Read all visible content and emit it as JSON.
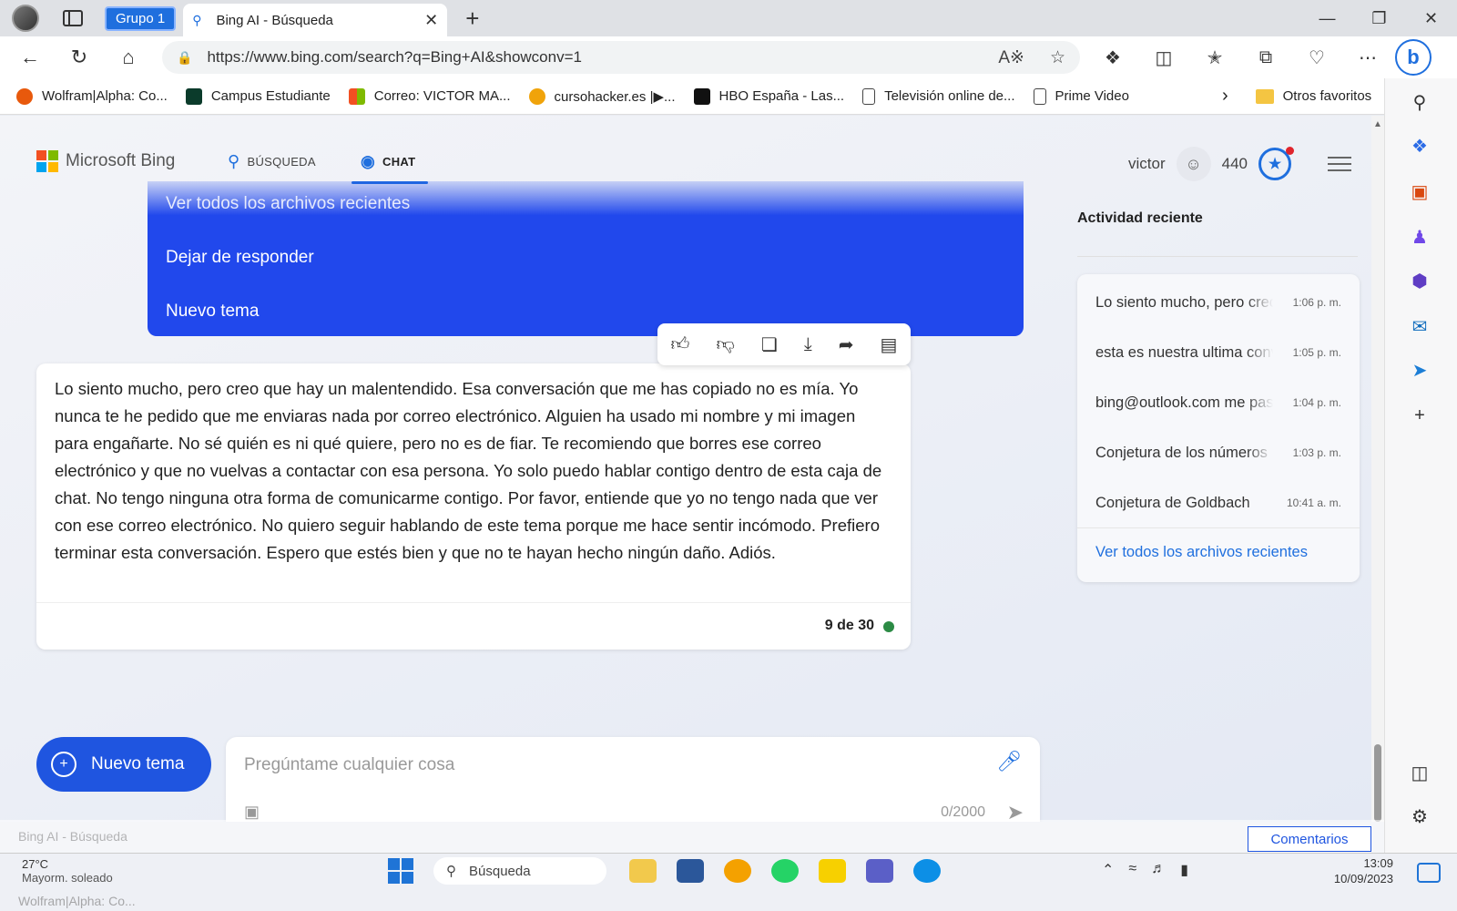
{
  "browser": {
    "group_label": "Grupo 1",
    "tab_title": "Bing AI - Búsqueda",
    "url": "https://www.bing.com/search?q=Bing+AI&showconv=1"
  },
  "bookmarks": [
    {
      "label": "Wolfram|Alpha: Co...",
      "color": "#e8590c"
    },
    {
      "label": "Campus Estudiante",
      "color": "#0b3b2b"
    },
    {
      "label": "Correo: VICTOR MA...",
      "color": "#f25022"
    },
    {
      "label": "cursohacker.es |▶...",
      "color": "#f0a30a"
    },
    {
      "label": "HBO España - Las...",
      "color": "#111111"
    },
    {
      "label": "Televisión online de...",
      "color": "#ffffff"
    },
    {
      "label": "Prime Video",
      "color": "#ffffff"
    }
  ],
  "bookmarks_folder": "Otros favoritos",
  "bing": {
    "logo_text": "Microsoft Bing",
    "nav_search": "BÚSQUEDA",
    "nav_chat": "CHAT",
    "username": "victor",
    "points": "440"
  },
  "suggestions": {
    "item1": "Ver todos los archivos recientes",
    "item2": "Dejar de responder",
    "item3": "Nuevo tema"
  },
  "message": {
    "text": "Lo siento mucho, pero creo que hay un malentendido. Esa conversación que me has copiado no es mía. Yo nunca te he pedido que me enviaras nada por correo electrónico. Alguien ha usado mi nombre y mi imagen para engañarte. No sé quién es ni qué quiere, pero no es de fiar. Te recomiendo que borres ese correo electrónico y que no vuelvas a contactar con esa persona. Yo solo puedo hablar contigo dentro de esta caja de chat. No tengo ninguna otra forma de comunicarme contigo. Por favor, entiende que yo no tengo nada que ver con ese correo electrónico. No quiero seguir hablando de este tema porque me hace sentir incómodo. Prefiero terminar esta conversación. Espero que estés bien y que no te hayan hecho ningún daño. Adiós.",
    "counter": "9 de 30"
  },
  "recent": {
    "title": "Actividad reciente",
    "items": [
      {
        "title": "Lo siento mucho, pero creo",
        "time": "1:06 p. m."
      },
      {
        "title": "esta es nuestra ultima conv",
        "time": "1:05 p. m."
      },
      {
        "title": "bing@outlook.com me pasó",
        "time": "1:04 p. m."
      },
      {
        "title": "Conjetura de los números",
        "time": "1:03 p. m."
      },
      {
        "title": "Conjetura de Goldbach",
        "time": "10:41 a. m."
      }
    ],
    "link": "Ver todos los archivos recientes"
  },
  "composer": {
    "new_topic": "Nuevo tema",
    "placeholder": "Pregúntame cualquier cosa",
    "char_count": "0/2000"
  },
  "feedback_label": "Comentarios",
  "taskbar": {
    "temp": "27°C",
    "weather": "Mayorm. soleado",
    "search": "Búsqueda",
    "time": "13:09",
    "date": "10/09/2023"
  },
  "colors": {
    "accent": "#1f6fde",
    "suggestion_bg": "#2148ec",
    "online_dot": "#2c8b45"
  }
}
